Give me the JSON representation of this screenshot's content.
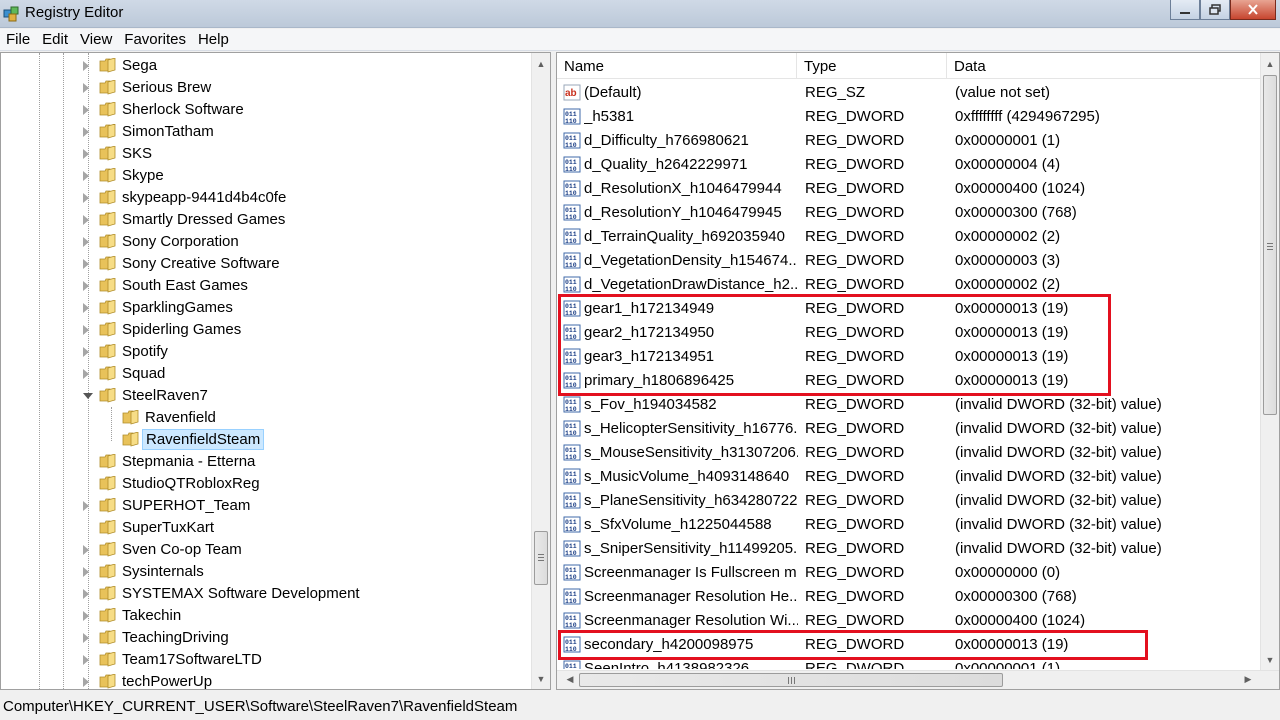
{
  "window": {
    "title": "Registry Editor"
  },
  "menu": [
    "File",
    "Edit",
    "View",
    "Favorites",
    "Help"
  ],
  "tree": {
    "items": [
      {
        "label": "Sega",
        "depth": 1,
        "expander": "closed"
      },
      {
        "label": "Serious Brew",
        "depth": 1,
        "expander": "closed"
      },
      {
        "label": "Sherlock Software",
        "depth": 1,
        "expander": "closed"
      },
      {
        "label": "SimonTatham",
        "depth": 1,
        "expander": "closed"
      },
      {
        "label": "SKS",
        "depth": 1,
        "expander": "closed"
      },
      {
        "label": "Skype",
        "depth": 1,
        "expander": "closed"
      },
      {
        "label": "skypeapp-9441d4b4c0fe",
        "depth": 1,
        "expander": "closed"
      },
      {
        "label": "Smartly Dressed Games",
        "depth": 1,
        "expander": "closed"
      },
      {
        "label": "Sony Corporation",
        "depth": 1,
        "expander": "closed"
      },
      {
        "label": "Sony Creative Software",
        "depth": 1,
        "expander": "closed"
      },
      {
        "label": "South East Games",
        "depth": 1,
        "expander": "closed"
      },
      {
        "label": "SparklingGames",
        "depth": 1,
        "expander": "closed"
      },
      {
        "label": "Spiderling Games",
        "depth": 1,
        "expander": "closed"
      },
      {
        "label": "Spotify",
        "depth": 1,
        "expander": "closed"
      },
      {
        "label": "Squad",
        "depth": 1,
        "expander": "closed"
      },
      {
        "label": "SteelRaven7",
        "depth": 1,
        "expander": "open"
      },
      {
        "label": "Ravenfield",
        "depth": 2,
        "expander": "none"
      },
      {
        "label": "RavenfieldSteam",
        "depth": 2,
        "expander": "none",
        "selected": true
      },
      {
        "label": "Stepmania - Etterna",
        "depth": 1,
        "expander": "none"
      },
      {
        "label": "StudioQTRobloxReg",
        "depth": 1,
        "expander": "none"
      },
      {
        "label": "SUPERHOT_Team",
        "depth": 1,
        "expander": "closed"
      },
      {
        "label": "SuperTuxKart",
        "depth": 1,
        "expander": "none"
      },
      {
        "label": "Sven Co-op Team",
        "depth": 1,
        "expander": "closed"
      },
      {
        "label": "Sysinternals",
        "depth": 1,
        "expander": "closed"
      },
      {
        "label": "SYSTEMAX Software Development",
        "depth": 1,
        "expander": "closed"
      },
      {
        "label": "Takechin",
        "depth": 1,
        "expander": "closed"
      },
      {
        "label": "TeachingDriving",
        "depth": 1,
        "expander": "closed"
      },
      {
        "label": "Team17SoftwareLTD",
        "depth": 1,
        "expander": "closed"
      },
      {
        "label": "techPowerUp",
        "depth": 1,
        "expander": "closed"
      }
    ]
  },
  "list": {
    "columns": [
      "Name",
      "Type",
      "Data"
    ],
    "rows": [
      {
        "name": "(Default)",
        "type": "REG_SZ",
        "data": "(value not set)",
        "icon": "string-value-icon"
      },
      {
        "name": "_h5381",
        "type": "REG_DWORD",
        "data": "0xffffffff (4294967295)",
        "icon": "binary-value-icon"
      },
      {
        "name": "d_Difficulty_h766980621",
        "type": "REG_DWORD",
        "data": "0x00000001 (1)",
        "icon": "binary-value-icon"
      },
      {
        "name": "d_Quality_h2642229971",
        "type": "REG_DWORD",
        "data": "0x00000004 (4)",
        "icon": "binary-value-icon"
      },
      {
        "name": "d_ResolutionX_h1046479944",
        "type": "REG_DWORD",
        "data": "0x00000400 (1024)",
        "icon": "binary-value-icon"
      },
      {
        "name": "d_ResolutionY_h1046479945",
        "type": "REG_DWORD",
        "data": "0x00000300 (768)",
        "icon": "binary-value-icon"
      },
      {
        "name": "d_TerrainQuality_h692035940",
        "type": "REG_DWORD",
        "data": "0x00000002 (2)",
        "icon": "binary-value-icon"
      },
      {
        "name": "d_VegetationDensity_h154674...",
        "type": "REG_DWORD",
        "data": "0x00000003 (3)",
        "icon": "binary-value-icon"
      },
      {
        "name": "d_VegetationDrawDistance_h2...",
        "type": "REG_DWORD",
        "data": "0x00000002 (2)",
        "icon": "binary-value-icon"
      },
      {
        "name": "gear1_h172134949",
        "type": "REG_DWORD",
        "data": "0x00000013 (19)",
        "icon": "binary-value-icon"
      },
      {
        "name": "gear2_h172134950",
        "type": "REG_DWORD",
        "data": "0x00000013 (19)",
        "icon": "binary-value-icon"
      },
      {
        "name": "gear3_h172134951",
        "type": "REG_DWORD",
        "data": "0x00000013 (19)",
        "icon": "binary-value-icon"
      },
      {
        "name": "primary_h1806896425",
        "type": "REG_DWORD",
        "data": "0x00000013 (19)",
        "icon": "binary-value-icon"
      },
      {
        "name": "s_Fov_h194034582",
        "type": "REG_DWORD",
        "data": "(invalid DWORD (32-bit) value)",
        "icon": "binary-value-icon"
      },
      {
        "name": "s_HelicopterSensitivity_h16776...",
        "type": "REG_DWORD",
        "data": "(invalid DWORD (32-bit) value)",
        "icon": "binary-value-icon"
      },
      {
        "name": "s_MouseSensitivity_h31307206...",
        "type": "REG_DWORD",
        "data": "(invalid DWORD (32-bit) value)",
        "icon": "binary-value-icon"
      },
      {
        "name": "s_MusicVolume_h4093148640",
        "type": "REG_DWORD",
        "data": "(invalid DWORD (32-bit) value)",
        "icon": "binary-value-icon"
      },
      {
        "name": "s_PlaneSensitivity_h634280722",
        "type": "REG_DWORD",
        "data": "(invalid DWORD (32-bit) value)",
        "icon": "binary-value-icon"
      },
      {
        "name": "s_SfxVolume_h1225044588",
        "type": "REG_DWORD",
        "data": "(invalid DWORD (32-bit) value)",
        "icon": "binary-value-icon"
      },
      {
        "name": "s_SniperSensitivity_h11499205...",
        "type": "REG_DWORD",
        "data": "(invalid DWORD (32-bit) value)",
        "icon": "binary-value-icon"
      },
      {
        "name": "Screenmanager Is Fullscreen m...",
        "type": "REG_DWORD",
        "data": "0x00000000 (0)",
        "icon": "binary-value-icon"
      },
      {
        "name": "Screenmanager Resolution He...",
        "type": "REG_DWORD",
        "data": "0x00000300 (768)",
        "icon": "binary-value-icon"
      },
      {
        "name": "Screenmanager Resolution Wi...",
        "type": "REG_DWORD",
        "data": "0x00000400 (1024)",
        "icon": "binary-value-icon"
      },
      {
        "name": "secondary_h4200098975",
        "type": "REG_DWORD",
        "data": "0x00000013 (19)",
        "icon": "binary-value-icon"
      },
      {
        "name": "SeenIntro_h4138982326",
        "type": "REG_DWORD",
        "data": "0x00000001 (1)",
        "icon": "binary-value-icon"
      }
    ]
  },
  "annotations": {
    "color": "#e3101f",
    "highlighted_rows": [
      [
        9,
        12
      ],
      [
        23,
        23
      ]
    ]
  },
  "status": {
    "path": "Computer\\HKEY_CURRENT_USER\\Software\\SteelRaven7\\RavenfieldSteam"
  }
}
